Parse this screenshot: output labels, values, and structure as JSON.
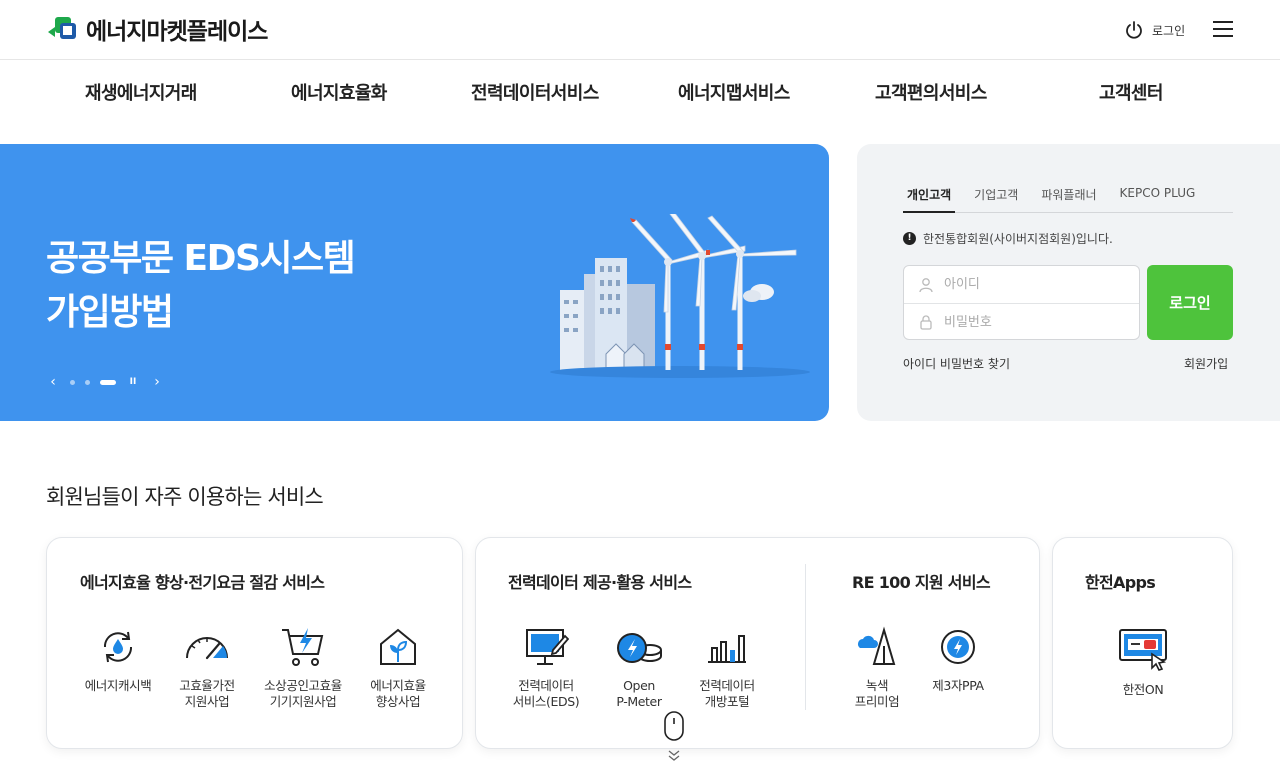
{
  "header": {
    "logo_text": "에너지마켓플레이스",
    "login_label": "로그인"
  },
  "nav": {
    "items": [
      "재생에너지거래",
      "에너지효율화",
      "전력데이터서비스",
      "에너지맵서비스",
      "고객편의서비스",
      "고객센터"
    ]
  },
  "hero": {
    "title_line1": "공공부문 EDS시스템",
    "title_line2": "가입방법",
    "slide_count": 4,
    "active_slide": 3,
    "prev_label": "‹",
    "next_label": "›",
    "pause_label": "II"
  },
  "login": {
    "tabs": [
      "개인고객",
      "기업고객",
      "파워플래너",
      "KEPCO PLUG"
    ],
    "active_tab": 0,
    "notice": "한전통합회원(사이버지점회원)입니다.",
    "id_placeholder": "아이디",
    "pw_placeholder": "비밀번호",
    "submit_label": "로그인",
    "find_label": "아이디 비밀번호 찾기",
    "join_label": "회원가입"
  },
  "services": {
    "section_title": "회원님들이 자주 이용하는 서비스",
    "card1": {
      "title": "에너지효율 향상·전기요금 절감 서비스",
      "items": [
        "에너지캐시백",
        "고효율가전\n지원사업",
        "소상공인고효율\n기기지원사업",
        "에너지효율\n향상사업"
      ]
    },
    "card2": {
      "title": "전력데이터 제공·활용 서비스",
      "items": [
        "전력데이터\n서비스(EDS)",
        "Open\nP-Meter",
        "전력데이터\n개방포털"
      ]
    },
    "card3": {
      "title": "RE 100 지원 서비스",
      "items": [
        "녹색\n프리미엄",
        "제3자PPA"
      ]
    },
    "card4": {
      "title": "한전Apps",
      "items": [
        "한전ON"
      ]
    }
  },
  "colors": {
    "hero_bg": "#3f93ee",
    "login_button": "#4ec33c",
    "icon_accent": "#1e88e5"
  }
}
